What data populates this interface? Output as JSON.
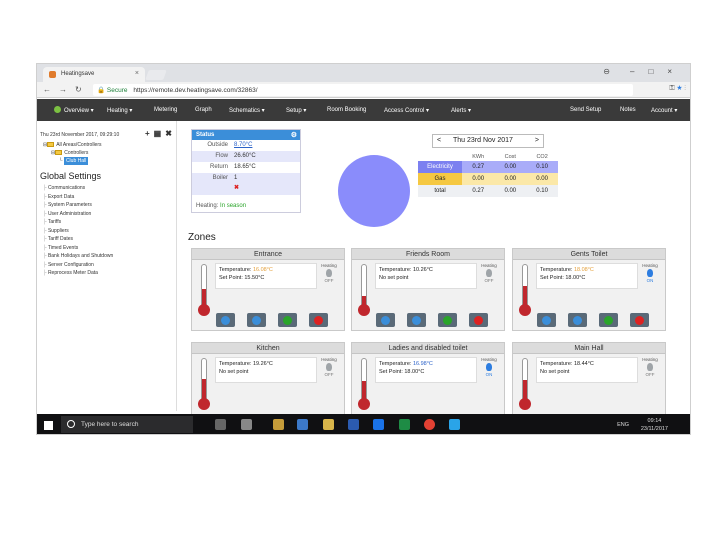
{
  "browser": {
    "tab_title": "Heatingsave",
    "secure_label": "Secure",
    "url": "https://remote.dev.heatingsave.com/32863/"
  },
  "nav": {
    "items": [
      "Overview ▾",
      "Heating ▾",
      "Metering",
      "Graph",
      "Schematics ▾",
      "Setup ▾",
      "Room Booking",
      "Access Control ▾",
      "Alerts ▾",
      "Send Setup",
      "Notes",
      "Account ▾"
    ]
  },
  "sidebar": {
    "date": "Thu 23rd November 2017, 09:29:10",
    "tree": {
      "root": "All Areas/Controllers",
      "group": "Controllers",
      "leaf": "Club Hall"
    },
    "global_title": "Global Settings",
    "global_items": [
      "Communications",
      "Export Data",
      "System Parameters",
      "User Administration",
      "Tariffs",
      "Suppliers",
      "Tariff Dates",
      "Timed Events",
      "Bank Holidays and Shutdown",
      "Server Configuration",
      "Reprocess Meter Data"
    ]
  },
  "status": {
    "title": "Status",
    "rows": [
      {
        "label": "Outside",
        "value": "8.70°C",
        "link": true
      },
      {
        "label": "Flow",
        "value": "26.60°C"
      },
      {
        "label": "Return",
        "value": "18.65°C"
      },
      {
        "label": "Boiler",
        "value": "1"
      }
    ],
    "heating_label": "Heating",
    "heating_value": "In season",
    "circle_color": "#8a8cfb"
  },
  "energy": {
    "date": "Thu 23rd Nov 2017",
    "prev": "<",
    "next": ">",
    "headers": [
      "",
      "KWh",
      "Cost",
      "CO2"
    ],
    "rows": [
      {
        "label": "Electricity",
        "values": [
          "0.27",
          "0.00",
          "0.10"
        ],
        "class": "elec"
      },
      {
        "label": "Gas",
        "values": [
          "0.00",
          "0.00",
          "0.00"
        ],
        "class": "gas"
      },
      {
        "label": "total",
        "values": [
          "0.27",
          "0.00",
          "0.10"
        ],
        "class": "total"
      }
    ]
  },
  "zones_title": "Zones",
  "zones": [
    {
      "name": "Entrance",
      "line1_label": "Temperature: ",
      "line1_value": "16.08°C",
      "line2": "Set Point: 15.50°C",
      "heating_label": "Heating",
      "state": "OFF",
      "flame": "grey",
      "level": 0.48,
      "highlight": "hl",
      "buttons": true
    },
    {
      "name": "Friends Room",
      "line1_label": "Temperature: ",
      "line1_value": "10.26°C",
      "line2": "No set point",
      "heating_label": "Heating",
      "state": "OFF",
      "flame": "grey",
      "level": 0.3,
      "highlight": "",
      "buttons": true
    },
    {
      "name": "Gents Toilet",
      "line1_label": "Temperature: ",
      "line1_value": "18.08°C",
      "line2": "Set Point: 18.00°C",
      "heating_label": "Heating",
      "state": "ON",
      "flame": "blue",
      "level": 0.55,
      "highlight": "hl",
      "buttons": true
    },
    {
      "name": "Kitchen",
      "line1_label": "Temperature: ",
      "line1_value": "19.26°C",
      "line2": "No set point",
      "heating_label": "Heating",
      "state": "OFF",
      "flame": "grey",
      "level": 0.58,
      "highlight": "",
      "buttons": false
    },
    {
      "name": "Ladies and disabled toilet",
      "line1_label": "Temperature: ",
      "line1_value": "16.98°C",
      "line2": "Set Point: 18.00°C",
      "heating_label": "Heating",
      "state": "ON",
      "flame": "blue",
      "level": 0.52,
      "highlight": "hlb",
      "buttons": false
    },
    {
      "name": "Main Hall",
      "line1_label": "Temperature: ",
      "line1_value": "18.44°C",
      "line2": "No set point",
      "heating_label": "Heating",
      "state": "OFF",
      "flame": "grey",
      "level": 0.55,
      "highlight": "",
      "buttons": false
    }
  ],
  "taskbar": {
    "search_text": "Type here to search",
    "lang": "ENG",
    "time": "09:14",
    "date": "23/11/2017"
  }
}
